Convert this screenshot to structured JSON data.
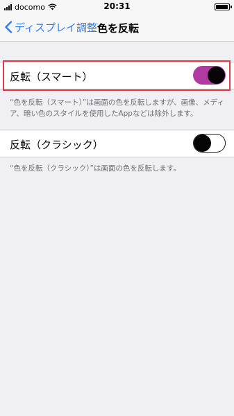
{
  "status_bar": {
    "carrier": "docomo",
    "time": "20:31",
    "signal_icon": "signal-bars-icon",
    "wifi_icon": "wifi-icon",
    "battery_icon": "battery-icon"
  },
  "nav": {
    "back_label": "ディスプレイ調整",
    "back_icon": "chevron-left-icon",
    "title": "色を反転",
    "accent_color": "#2f7cf6"
  },
  "smart_invert": {
    "label": "反転（スマート）",
    "toggle_on": true,
    "toggle_color": "#b03aa0",
    "highlighted": true,
    "highlight_color": "#e23a44",
    "footer": "“色を反転（スマート）”は画面の色を反転しますが、画像、メディア、暗い色のスタイルを使用したAppなどは除外します。"
  },
  "classic_invert": {
    "label": "反転（クラシック）",
    "toggle_on": false,
    "footer": "“色を反転（クラシック）”は画面の色を反転します。"
  }
}
